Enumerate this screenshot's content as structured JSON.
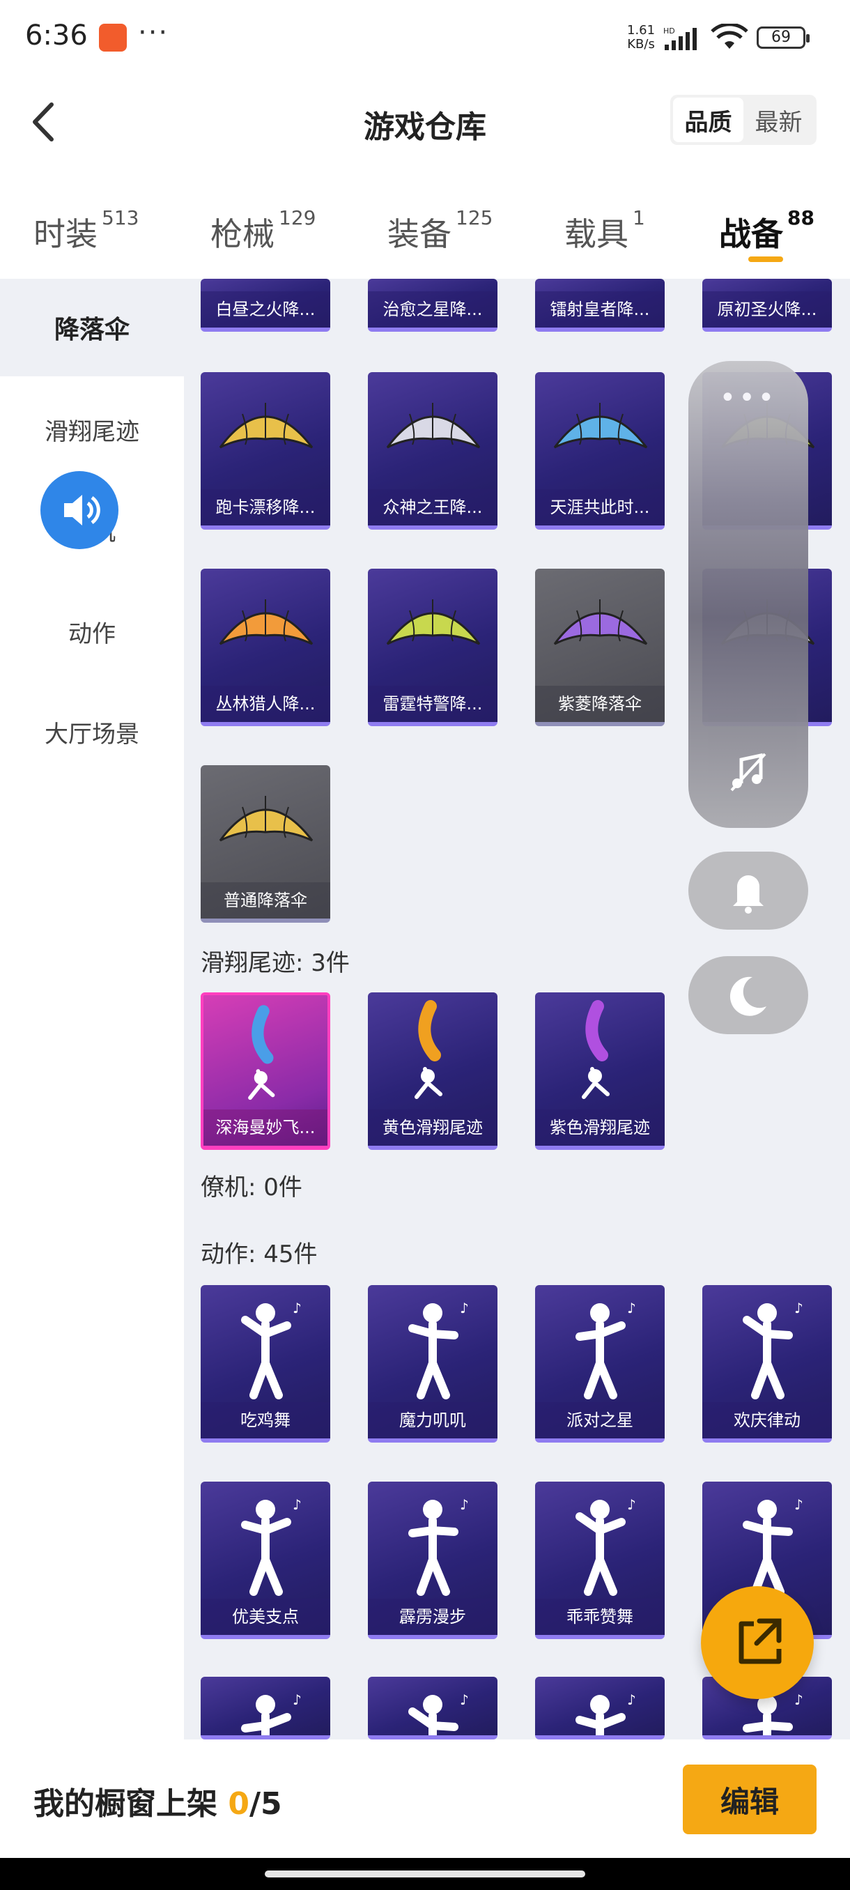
{
  "status": {
    "time": "6:36",
    "app_icon": "app-notification-icon",
    "more": "···",
    "net_speed_value": "1.61",
    "net_speed_unit": "KB/s",
    "hd": "HD",
    "battery": "69"
  },
  "header": {
    "title": "游戏仓库",
    "sort_options": [
      "品质",
      "最新"
    ],
    "sort_selected": "品质"
  },
  "tabs": [
    {
      "label": "时装",
      "count": "513"
    },
    {
      "label": "枪械",
      "count": "129"
    },
    {
      "label": "装备",
      "count": "125"
    },
    {
      "label": "载具",
      "count": "1"
    },
    {
      "label": "战备",
      "count": "88",
      "active": true
    }
  ],
  "sidebar": {
    "items": [
      "降落伞",
      "滑翔尾迹",
      "僚机",
      "动作",
      "大厅场景"
    ],
    "active": "降落伞"
  },
  "parachutes_partial_row": [
    "白昼之火降...",
    "治愈之星降...",
    "镭射皇者降...",
    "原初圣火降..."
  ],
  "parachutes": [
    {
      "label": "跑卡漂移降...",
      "style": "purple"
    },
    {
      "label": "众神之王降...",
      "style": "purple"
    },
    {
      "label": "天涯共此时...",
      "style": "purple"
    },
    {
      "label": "丛林猎人降...",
      "style": "purple"
    },
    {
      "label": "雷霆特警降...",
      "style": "purple"
    },
    {
      "label": "紫菱降落伞",
      "style": "gray"
    },
    {
      "label": "普通降落伞",
      "style": "gray"
    }
  ],
  "trails_section": "滑翔尾迹: 3件",
  "trails": [
    {
      "label": "深海曼妙飞...",
      "style": "pink"
    },
    {
      "label": "黄色滑翔尾迹",
      "style": "purple"
    },
    {
      "label": "紫色滑翔尾迹",
      "style": "purple"
    }
  ],
  "wingman_section": "僚机: 0件",
  "emotes_section": "动作: 45件",
  "emotes": [
    "吃鸡舞",
    "魔力叽叽",
    "派对之星",
    "欢庆律动",
    "优美支点",
    "霹雳漫步",
    "乖乖赞舞",
    ""
  ],
  "bottom": {
    "window_label": "我的橱窗上架",
    "window_current": "0",
    "window_total": "/5",
    "edit": "编辑"
  },
  "colors": {
    "accent": "#f5a814",
    "card_purple": "#2b2377",
    "card_gray": "#55555c",
    "card_pink": "#d63eb6",
    "blue_button": "#2f86e8"
  }
}
